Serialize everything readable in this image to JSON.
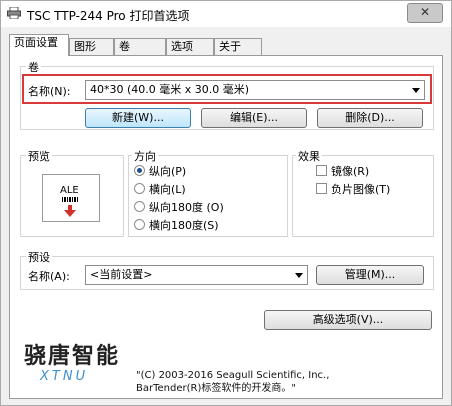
{
  "window": {
    "title": "TSC TTP-244 Pro 打印首选项",
    "close_label": "✕"
  },
  "tabs": [
    {
      "label": "页面设置",
      "active": true
    },
    {
      "label": "图形",
      "active": false
    },
    {
      "label": "卷",
      "active": false
    },
    {
      "label": "选项",
      "active": false
    },
    {
      "label": "关于",
      "active": false
    }
  ],
  "roll_group": {
    "label": "卷",
    "name_label": "名称(N):",
    "name_value": "40*30 (40.0 毫米 x 30.0 毫米)",
    "buttons": {
      "new": "新建(W)...",
      "edit": "编辑(E)...",
      "delete": "删除(D)..."
    }
  },
  "preview": {
    "label": "预览",
    "sample_text": "ALE"
  },
  "orientation": {
    "label": "方向",
    "options": [
      {
        "label": "纵向(P)",
        "selected": true
      },
      {
        "label": "横向(L)",
        "selected": false
      },
      {
        "label": "纵向180度 (O)",
        "selected": false
      },
      {
        "label": "横向180度(S)",
        "selected": false
      }
    ]
  },
  "effects": {
    "label": "效果",
    "options": [
      {
        "label": "镜像(R)",
        "checked": false
      },
      {
        "label": "负片图像(T)",
        "checked": false
      }
    ]
  },
  "presets": {
    "label": "预设",
    "name_label": "名称(A):",
    "name_value": "<当前设置>",
    "manage_button": "管理(M)..."
  },
  "advanced_button": "高级选项(V)...",
  "branding": {
    "watermark_text": "骁唐智能",
    "watermark_logo": "XTNU",
    "copyright_line1": "\"(C) 2003-2016 Seagull Scientific, Inc.,",
    "copyright_line2": "BarTender(R)标签软件的开发商。\""
  },
  "colors": {
    "highlight_frame": "#d83a3a",
    "default_button": "#bee6fd",
    "logo_blue": "#3a8fd0"
  }
}
